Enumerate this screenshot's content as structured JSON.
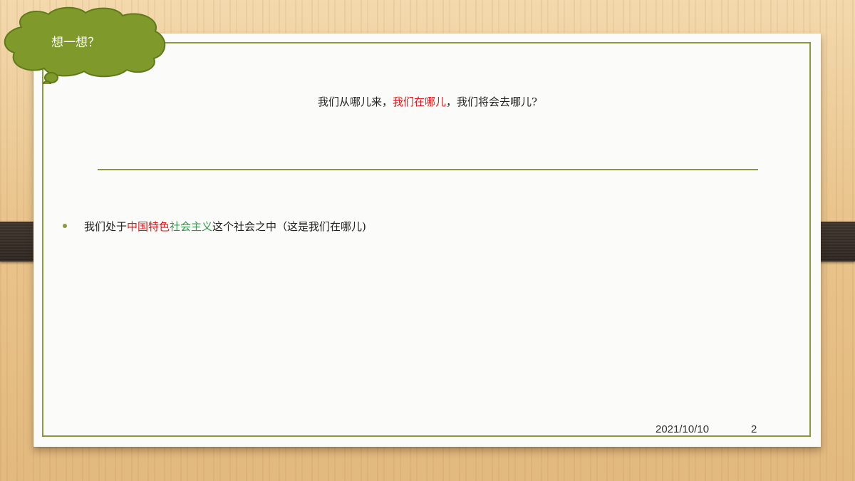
{
  "cloud": {
    "title": "想一想？",
    "fill_color": "#7f9a2b",
    "stroke_color": "#5f7a1a"
  },
  "heading": {
    "part1": "我们从哪儿来，",
    "part2_red": "我们在哪儿",
    "part3": "，我们将会去哪儿?"
  },
  "bullet": {
    "text_before": "我们处于",
    "text_red": "中国特色",
    "text_green": "社会主义",
    "text_after": "这个社会之中（这是我们在哪儿)"
  },
  "footer": {
    "date": "2021/10/10",
    "page_number": "2"
  },
  "colors": {
    "accent_green": "#8a9a3a",
    "highlight_red": "#e01818",
    "highlight_green": "#2f9a4a",
    "clip_dark": "#3a302a"
  }
}
